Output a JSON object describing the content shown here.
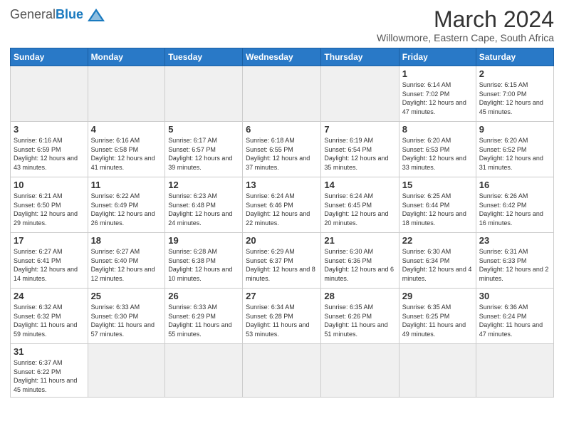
{
  "logo": {
    "general": "General",
    "blue": "Blue"
  },
  "title": "March 2024",
  "subtitle": "Willowmore, Eastern Cape, South Africa",
  "days_of_week": [
    "Sunday",
    "Monday",
    "Tuesday",
    "Wednesday",
    "Thursday",
    "Friday",
    "Saturday"
  ],
  "weeks": [
    [
      {
        "day": "",
        "info": "",
        "empty": true
      },
      {
        "day": "",
        "info": "",
        "empty": true
      },
      {
        "day": "",
        "info": "",
        "empty": true
      },
      {
        "day": "",
        "info": "",
        "empty": true
      },
      {
        "day": "",
        "info": "",
        "empty": true
      },
      {
        "day": "1",
        "info": "Sunrise: 6:14 AM\nSunset: 7:02 PM\nDaylight: 12 hours\nand 47 minutes."
      },
      {
        "day": "2",
        "info": "Sunrise: 6:15 AM\nSunset: 7:00 PM\nDaylight: 12 hours\nand 45 minutes."
      }
    ],
    [
      {
        "day": "3",
        "info": "Sunrise: 6:16 AM\nSunset: 6:59 PM\nDaylight: 12 hours\nand 43 minutes."
      },
      {
        "day": "4",
        "info": "Sunrise: 6:16 AM\nSunset: 6:58 PM\nDaylight: 12 hours\nand 41 minutes."
      },
      {
        "day": "5",
        "info": "Sunrise: 6:17 AM\nSunset: 6:57 PM\nDaylight: 12 hours\nand 39 minutes."
      },
      {
        "day": "6",
        "info": "Sunrise: 6:18 AM\nSunset: 6:55 PM\nDaylight: 12 hours\nand 37 minutes."
      },
      {
        "day": "7",
        "info": "Sunrise: 6:19 AM\nSunset: 6:54 PM\nDaylight: 12 hours\nand 35 minutes."
      },
      {
        "day": "8",
        "info": "Sunrise: 6:20 AM\nSunset: 6:53 PM\nDaylight: 12 hours\nand 33 minutes."
      },
      {
        "day": "9",
        "info": "Sunrise: 6:20 AM\nSunset: 6:52 PM\nDaylight: 12 hours\nand 31 minutes."
      }
    ],
    [
      {
        "day": "10",
        "info": "Sunrise: 6:21 AM\nSunset: 6:50 PM\nDaylight: 12 hours\nand 29 minutes."
      },
      {
        "day": "11",
        "info": "Sunrise: 6:22 AM\nSunset: 6:49 PM\nDaylight: 12 hours\nand 26 minutes."
      },
      {
        "day": "12",
        "info": "Sunrise: 6:23 AM\nSunset: 6:48 PM\nDaylight: 12 hours\nand 24 minutes."
      },
      {
        "day": "13",
        "info": "Sunrise: 6:24 AM\nSunset: 6:46 PM\nDaylight: 12 hours\nand 22 minutes."
      },
      {
        "day": "14",
        "info": "Sunrise: 6:24 AM\nSunset: 6:45 PM\nDaylight: 12 hours\nand 20 minutes."
      },
      {
        "day": "15",
        "info": "Sunrise: 6:25 AM\nSunset: 6:44 PM\nDaylight: 12 hours\nand 18 minutes."
      },
      {
        "day": "16",
        "info": "Sunrise: 6:26 AM\nSunset: 6:42 PM\nDaylight: 12 hours\nand 16 minutes."
      }
    ],
    [
      {
        "day": "17",
        "info": "Sunrise: 6:27 AM\nSunset: 6:41 PM\nDaylight: 12 hours\nand 14 minutes."
      },
      {
        "day": "18",
        "info": "Sunrise: 6:27 AM\nSunset: 6:40 PM\nDaylight: 12 hours\nand 12 minutes."
      },
      {
        "day": "19",
        "info": "Sunrise: 6:28 AM\nSunset: 6:38 PM\nDaylight: 12 hours\nand 10 minutes."
      },
      {
        "day": "20",
        "info": "Sunrise: 6:29 AM\nSunset: 6:37 PM\nDaylight: 12 hours\nand 8 minutes."
      },
      {
        "day": "21",
        "info": "Sunrise: 6:30 AM\nSunset: 6:36 PM\nDaylight: 12 hours\nand 6 minutes."
      },
      {
        "day": "22",
        "info": "Sunrise: 6:30 AM\nSunset: 6:34 PM\nDaylight: 12 hours\nand 4 minutes."
      },
      {
        "day": "23",
        "info": "Sunrise: 6:31 AM\nSunset: 6:33 PM\nDaylight: 12 hours\nand 2 minutes."
      }
    ],
    [
      {
        "day": "24",
        "info": "Sunrise: 6:32 AM\nSunset: 6:32 PM\nDaylight: 11 hours\nand 59 minutes."
      },
      {
        "day": "25",
        "info": "Sunrise: 6:33 AM\nSunset: 6:30 PM\nDaylight: 11 hours\nand 57 minutes."
      },
      {
        "day": "26",
        "info": "Sunrise: 6:33 AM\nSunset: 6:29 PM\nDaylight: 11 hours\nand 55 minutes."
      },
      {
        "day": "27",
        "info": "Sunrise: 6:34 AM\nSunset: 6:28 PM\nDaylight: 11 hours\nand 53 minutes."
      },
      {
        "day": "28",
        "info": "Sunrise: 6:35 AM\nSunset: 6:26 PM\nDaylight: 11 hours\nand 51 minutes."
      },
      {
        "day": "29",
        "info": "Sunrise: 6:35 AM\nSunset: 6:25 PM\nDaylight: 11 hours\nand 49 minutes."
      },
      {
        "day": "30",
        "info": "Sunrise: 6:36 AM\nSunset: 6:24 PM\nDaylight: 11 hours\nand 47 minutes."
      }
    ],
    [
      {
        "day": "31",
        "info": "Sunrise: 6:37 AM\nSunset: 6:22 PM\nDaylight: 11 hours\nand 45 minutes."
      },
      {
        "day": "",
        "info": "",
        "empty": true
      },
      {
        "day": "",
        "info": "",
        "empty": true
      },
      {
        "day": "",
        "info": "",
        "empty": true
      },
      {
        "day": "",
        "info": "",
        "empty": true
      },
      {
        "day": "",
        "info": "",
        "empty": true
      },
      {
        "day": "",
        "info": "",
        "empty": true
      }
    ]
  ]
}
